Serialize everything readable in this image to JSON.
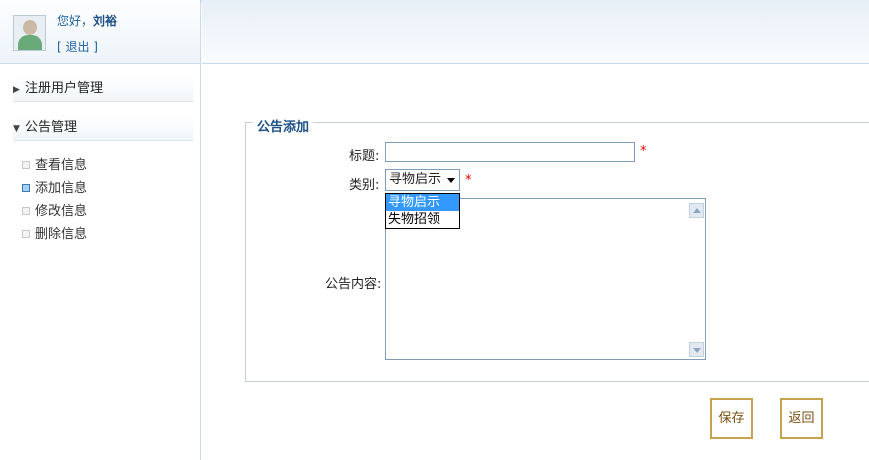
{
  "user": {
    "greeting": "您好，",
    "name": "刘裕",
    "logout": "[ 退出 ]"
  },
  "sidebar": {
    "groups": [
      {
        "label": "注册用户管理",
        "arrow": "▶"
      },
      {
        "label": "公告管理",
        "arrow": "▼"
      }
    ],
    "items": [
      {
        "label": "查看信息"
      },
      {
        "label": "添加信息"
      },
      {
        "label": "修改信息"
      },
      {
        "label": "删除信息"
      }
    ]
  },
  "form": {
    "legend": "公告添加",
    "title_label": "标题:",
    "title_value": "",
    "category_label": "类别:",
    "category_selected": "寻物启示",
    "category_options": [
      "寻物启示",
      "失物招领"
    ],
    "content_label": "公告内容:",
    "required_mark": "*"
  },
  "buttons": {
    "save": "保存",
    "back": "返回"
  }
}
